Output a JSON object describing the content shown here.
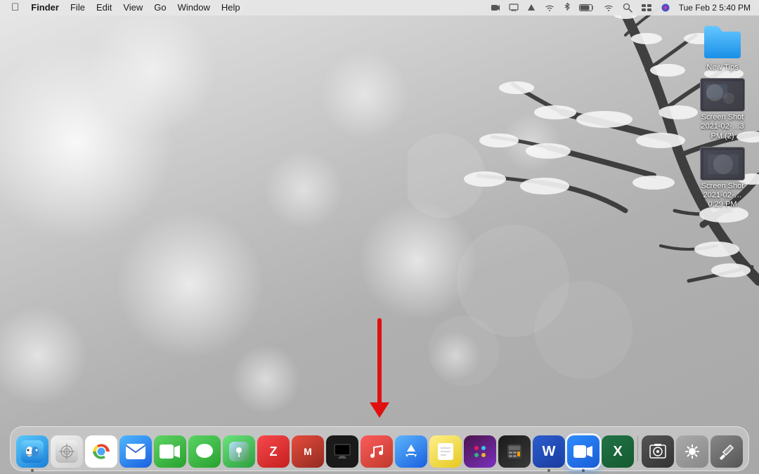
{
  "menubar": {
    "apple": "⌘",
    "app_name": "Finder",
    "menus": [
      "File",
      "Edit",
      "View",
      "Go",
      "Window",
      "Help"
    ],
    "time": "Tue Feb 2  5:40 PM",
    "status_icons": [
      "📹",
      "⚡",
      "🔵",
      "✈",
      "📶",
      "🔋",
      "📶",
      "🔍",
      "📋",
      "🔊"
    ]
  },
  "desktop_icons": [
    {
      "id": "new-tips",
      "type": "folder",
      "label": "New Tips"
    },
    {
      "id": "screenshot1",
      "type": "screenshot",
      "label": "Screen Shot\n2021-02-... 3 PM (2)"
    },
    {
      "id": "screenshot2",
      "type": "screenshot",
      "label": "Screen Shot\n2021-02-... 0:29 PM"
    }
  ],
  "dock": {
    "apps": [
      {
        "id": "finder",
        "label": "Finder",
        "symbol": "🔵",
        "running": true
      },
      {
        "id": "launchpad",
        "label": "Launchpad",
        "symbol": "⊞",
        "running": false
      },
      {
        "id": "chrome",
        "label": "Google Chrome",
        "symbol": "●",
        "running": true
      },
      {
        "id": "mail",
        "label": "Mail",
        "symbol": "✉",
        "running": false
      },
      {
        "id": "facetime",
        "label": "FaceTime",
        "symbol": "📷",
        "running": false
      },
      {
        "id": "messages",
        "label": "Messages",
        "symbol": "💬",
        "running": false
      },
      {
        "id": "maps",
        "label": "Maps",
        "symbol": "🗺",
        "running": false
      },
      {
        "id": "zed",
        "label": "Zed",
        "symbol": "Z",
        "running": false
      },
      {
        "id": "multipass",
        "label": "Multipass",
        "symbol": "M",
        "running": false
      },
      {
        "id": "tv",
        "label": "Apple TV",
        "symbol": "▶",
        "running": false
      },
      {
        "id": "music",
        "label": "Music",
        "symbol": "♪",
        "running": false
      },
      {
        "id": "appstore",
        "label": "App Store",
        "symbol": "A",
        "running": false
      },
      {
        "id": "notes",
        "label": "Notes",
        "symbol": "📝",
        "running": false
      },
      {
        "id": "slack",
        "label": "Slack",
        "symbol": "#",
        "running": false
      },
      {
        "id": "calculator",
        "label": "Calculator",
        "symbol": "=",
        "running": false
      },
      {
        "id": "word",
        "label": "Microsoft Word",
        "symbol": "W",
        "running": true
      },
      {
        "id": "zoom",
        "label": "Zoom",
        "symbol": "📹",
        "running": true,
        "highlighted": true
      },
      {
        "id": "excel",
        "label": "Microsoft Excel",
        "symbol": "X",
        "running": false
      },
      {
        "id": "screenrecord",
        "label": "Screenshot",
        "symbol": "⬜",
        "running": false
      },
      {
        "id": "prefs",
        "label": "System Preferences",
        "symbol": "⚙",
        "running": false
      },
      {
        "id": "tools",
        "label": "Tools",
        "symbol": "🔧",
        "running": false
      }
    ]
  },
  "arrow": {
    "color": "#e01010",
    "pointing_to": "zoom_icon"
  }
}
